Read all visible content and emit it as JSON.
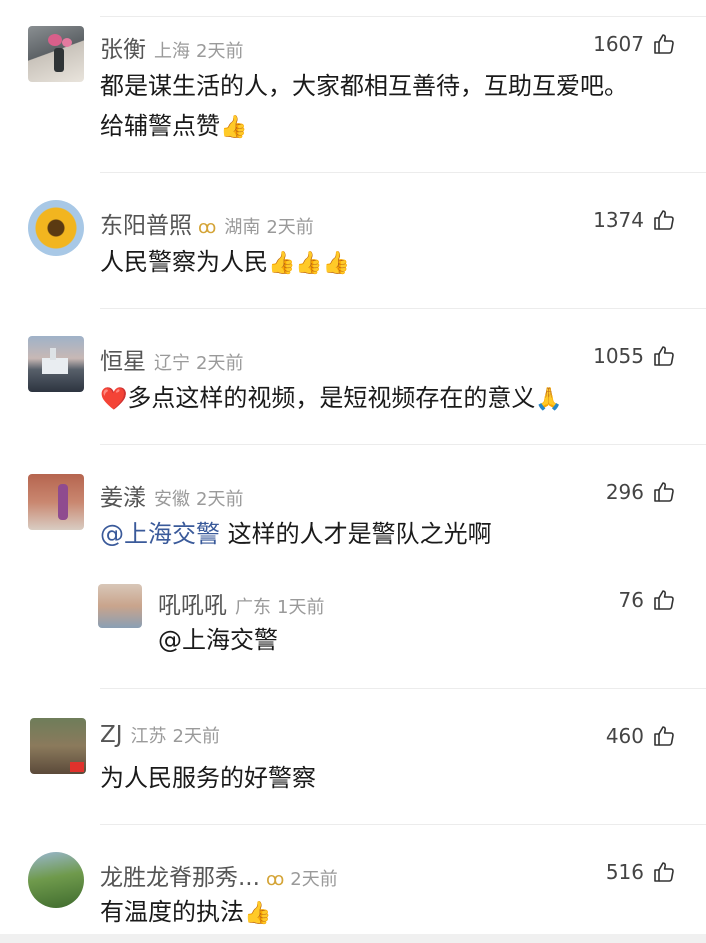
{
  "comments": [
    {
      "name": "张衡",
      "location": "上海",
      "time": "2天前",
      "likes": "1607",
      "text_line1": "都是谋生活的人，大家都相互善待，互助互爱吧。",
      "text_line2": "给辅警点赞",
      "emojis": [
        "👍"
      ]
    },
    {
      "name": "东阳普照",
      "badge": "ꝏ",
      "location": "湖南",
      "time": "2天前",
      "likes": "1374",
      "text": "人民警察为人民",
      "emojis": [
        "👍",
        "👍",
        "👍"
      ]
    },
    {
      "name": "恒星",
      "location": "辽宁",
      "time": "2天前",
      "likes": "1055",
      "text": "多点这样的视频，是短视频存在的意义",
      "emojis": [
        "❤️",
        "🙏"
      ]
    },
    {
      "name": "姜漾",
      "location": "安徽",
      "time": "2天前",
      "likes": "296",
      "mention": "@上海交警",
      "text": " 这样的人才是警队之光啊"
    },
    {
      "name": "吼吼吼",
      "location": "广东",
      "time": "1天前",
      "likes": "76",
      "mention": "@上海交警",
      "is_reply": true
    },
    {
      "name": "ZJ",
      "location": "江苏",
      "time": "2天前",
      "likes": "460",
      "text": "为人民服务的好警察"
    },
    {
      "name": "龙胜龙脊那秀...",
      "badge": "ꝏ",
      "time": "2天前",
      "likes": "516",
      "text": "有温度的执法",
      "emojis": [
        "👍"
      ]
    }
  ],
  "icons": {
    "like": "thumbs-up-outline-icon"
  },
  "colors": {
    "name": "#555555",
    "meta": "#9a9a9a",
    "mention": "#3a5a9a",
    "badge": "#d4a437"
  }
}
